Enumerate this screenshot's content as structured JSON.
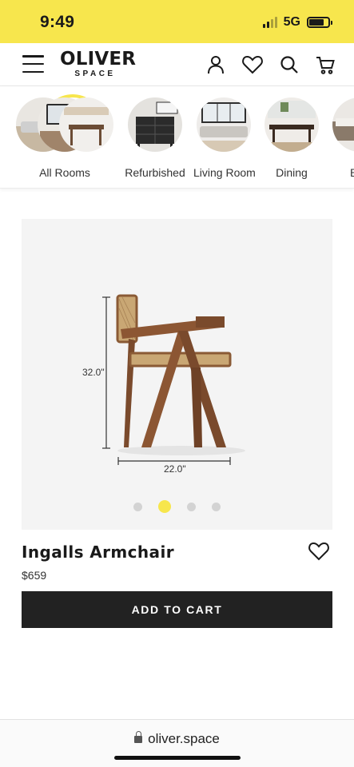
{
  "status_bar": {
    "time": "9:49",
    "network": "5G"
  },
  "header": {
    "logo_main": "OLIVER",
    "logo_sub": "SPACE",
    "icons": [
      "menu-icon",
      "user-icon",
      "heart-icon",
      "search-icon",
      "cart-icon"
    ]
  },
  "categories": [
    {
      "label": "All Rooms",
      "icon": "all-rooms-thumbnail"
    },
    {
      "label": "Refurbished",
      "icon": "dresser-thumbnail"
    },
    {
      "label": "Living Room",
      "icon": "living-room-thumbnail"
    },
    {
      "label": "Dining",
      "icon": "dining-thumbnail"
    },
    {
      "label": "Bec",
      "icon": "bedroom-thumbnail"
    }
  ],
  "product": {
    "name": "Ingalls Armchair",
    "price": "$659",
    "height_label": "32.0\"",
    "width_label": "22.0\"",
    "image_count": 4,
    "active_image": 2,
    "add_to_cart": "ADD TO CART"
  },
  "browser": {
    "url": "oliver.space"
  },
  "colors": {
    "accent": "#f7e64d",
    "button": "#222222",
    "gallery_bg": "#f4f4f4"
  }
}
